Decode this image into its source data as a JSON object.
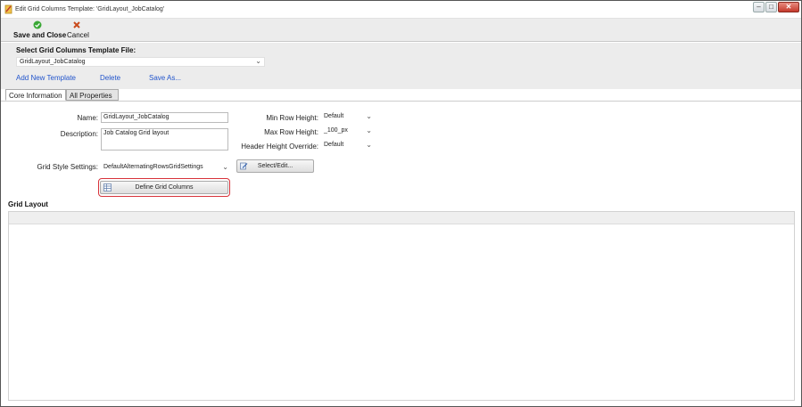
{
  "window": {
    "title": "Edit Grid Columns Template: 'GridLayout_JobCatalog'",
    "controls": {
      "minimize": "–",
      "maximize": "□",
      "close": "✕"
    }
  },
  "toolbar": {
    "save_label": "Save and Close",
    "save_icon": "green-check-icon",
    "cancel_label": "Cancel",
    "cancel_icon": "x-icon"
  },
  "file_panel": {
    "heading": "Select Grid Columns Template File:",
    "selected_file": "GridLayout_JobCatalog",
    "links": {
      "add_new": "Add New Template",
      "delete": "Delete",
      "save_as": "Save As..."
    }
  },
  "tabs": [
    {
      "label": "Core Information",
      "active": true
    },
    {
      "label": "All Properties",
      "active": false
    }
  ],
  "core": {
    "name_label": "Name:",
    "name_value": "GridLayout_JobCatalog",
    "description_label": "Description:",
    "description_value": "Job Catalog Grid layout",
    "min_row_height_label": "Min Row Height:",
    "min_row_height_value": "Default",
    "max_row_height_label": "Max Row Height:",
    "max_row_height_value": "_100_px",
    "header_height_label": "Header Height Override:",
    "header_height_value": "Default",
    "grid_style_label": "Grid Style Settings:",
    "grid_style_value": "DefaultAlternatingRowsGridSettings",
    "select_edit_label": "Select/Edit...",
    "define_columns_label": "Define Grid Columns"
  },
  "grid_layout": {
    "title": "Grid Layout"
  },
  "colors": {
    "accent_link": "#2255cc",
    "highlight": "#d8323a",
    "panel_bg": "#ececec",
    "save_icon": "#3aa835",
    "cancel_icon": "#c94a1c"
  }
}
